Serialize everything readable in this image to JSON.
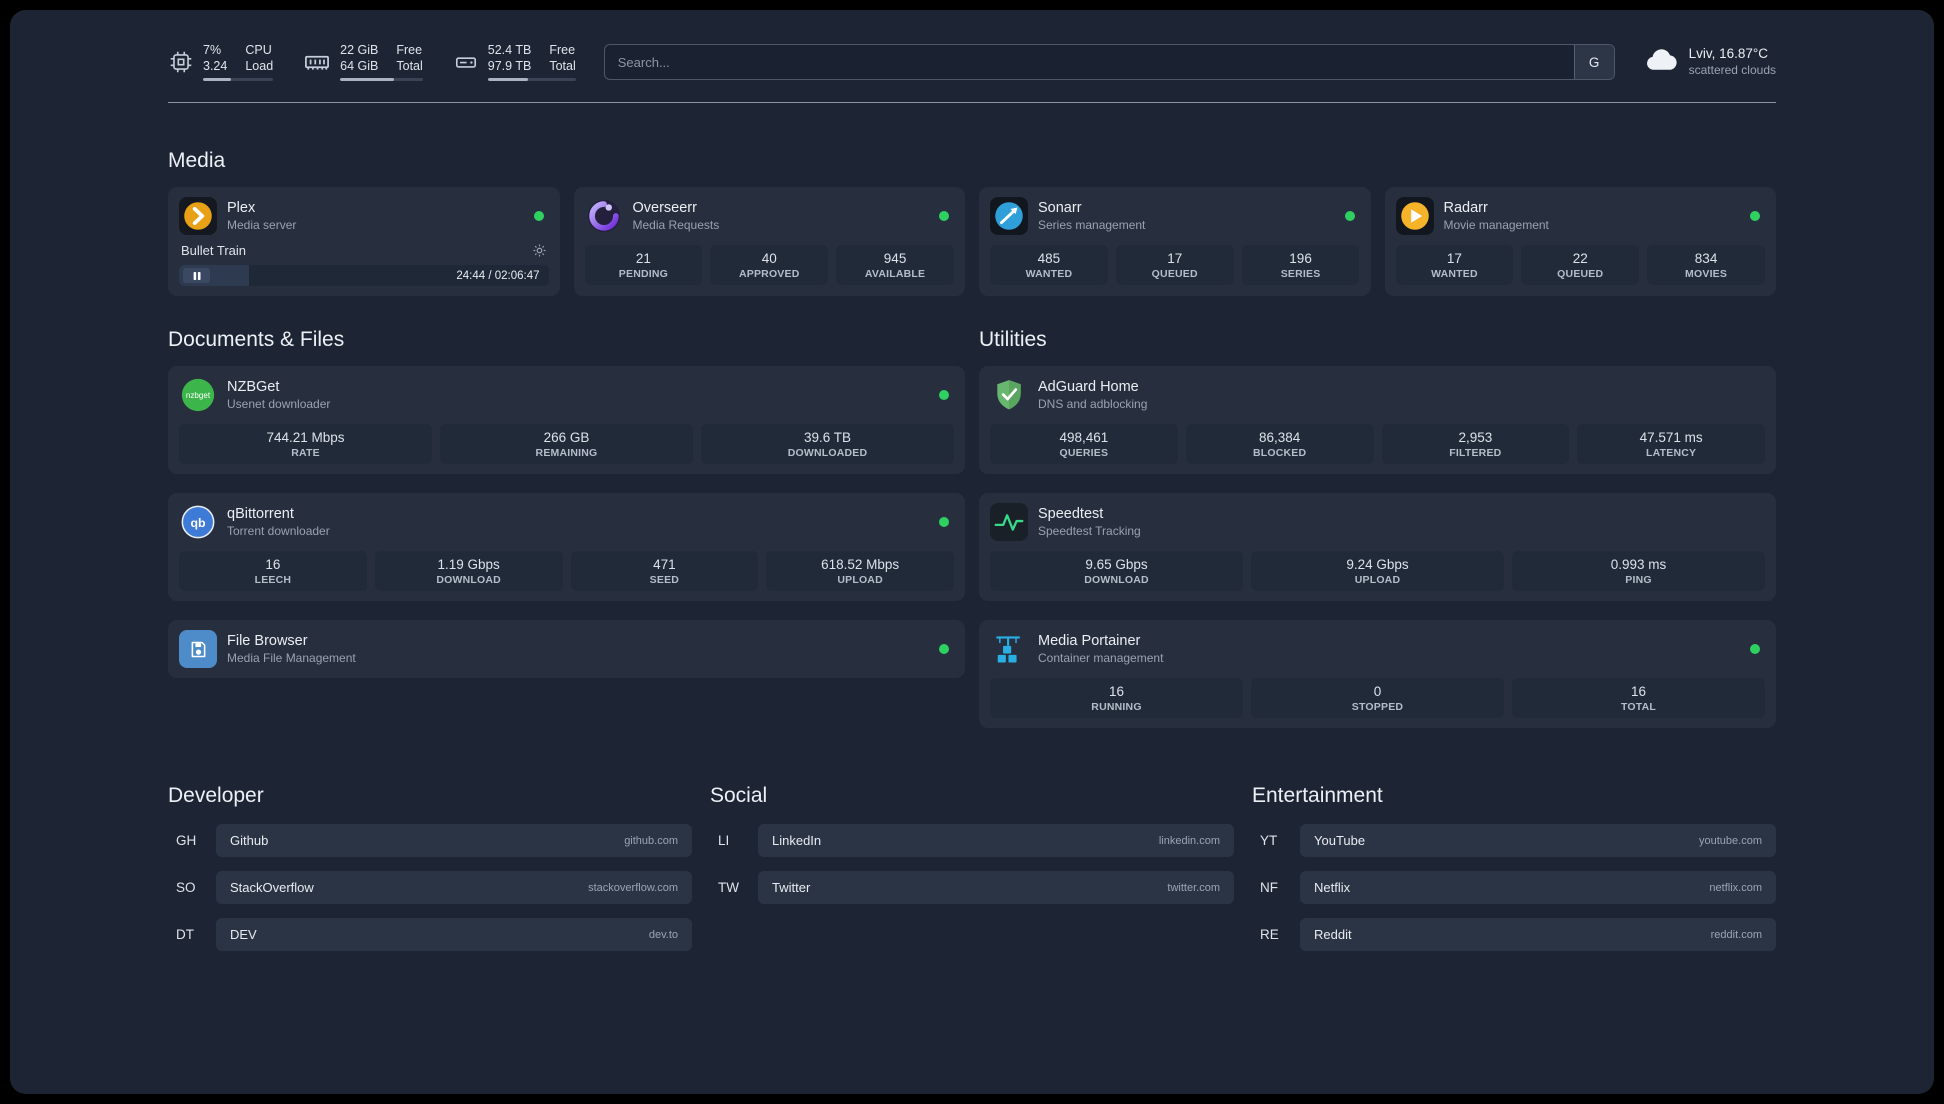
{
  "topbar": {
    "cpu": {
      "line1": "7%",
      "line2": "3.24",
      "label1": "CPU",
      "label2": "Load",
      "bar_percent": 40
    },
    "memory": {
      "line1": "22 GiB",
      "line2": "64 GiB",
      "label1": "Free",
      "label2": "Total",
      "bar_percent": 65
    },
    "disk": {
      "line1": "52.4 TB",
      "line2": "97.9 TB",
      "label1": "Free",
      "label2": "Total",
      "bar_percent": 46
    },
    "search": {
      "placeholder": "Search...",
      "provider": "G"
    },
    "weather": {
      "location": "Lviv, 16.87°C",
      "condition": "scattered clouds"
    }
  },
  "groups": [
    {
      "title": "Media",
      "cards": [
        {
          "name": "Plex",
          "subtitle": "Media server",
          "icon": "plex-icon",
          "status_online": true,
          "player": {
            "title": "Bullet Train",
            "time": "24:44 / 02:06:47",
            "progress_percent": 19
          }
        },
        {
          "name": "Overseerr",
          "subtitle": "Media Requests",
          "icon": "overseerr-icon",
          "status_online": true,
          "stats": [
            {
              "value": "21",
              "label": "PENDING"
            },
            {
              "value": "40",
              "label": "APPROVED"
            },
            {
              "value": "945",
              "label": "AVAILABLE"
            }
          ]
        },
        {
          "name": "Sonarr",
          "subtitle": "Series management",
          "icon": "sonarr-icon",
          "status_online": true,
          "stats": [
            {
              "value": "485",
              "label": "WANTED"
            },
            {
              "value": "17",
              "label": "QUEUED"
            },
            {
              "value": "196",
              "label": "SERIES"
            }
          ]
        },
        {
          "name": "Radarr",
          "subtitle": "Movie management",
          "icon": "radarr-icon",
          "status_online": true,
          "stats": [
            {
              "value": "17",
              "label": "WANTED"
            },
            {
              "value": "22",
              "label": "QUEUED"
            },
            {
              "value": "834",
              "label": "MOVIES"
            }
          ]
        }
      ]
    },
    {
      "title": "Documents & Files",
      "cards": [
        {
          "name": "NZBGet",
          "subtitle": "Usenet downloader",
          "icon": "nzbget-icon",
          "status_online": true,
          "stats": [
            {
              "value": "744.21 Mbps",
              "label": "RATE"
            },
            {
              "value": "266 GB",
              "label": "REMAINING"
            },
            {
              "value": "39.6 TB",
              "label": "DOWNLOADED"
            }
          ]
        },
        {
          "name": "qBittorrent",
          "subtitle": "Torrent downloader",
          "icon": "qbittorrent-icon",
          "status_online": true,
          "stats": [
            {
              "value": "16",
              "label": "LEECH"
            },
            {
              "value": "1.19 Gbps",
              "label": "DOWNLOAD"
            },
            {
              "value": "471",
              "label": "SEED"
            },
            {
              "value": "618.52 Mbps",
              "label": "UPLOAD"
            }
          ]
        },
        {
          "name": "File Browser",
          "subtitle": "Media File Management",
          "icon": "filebrowser-icon",
          "status_online": true
        }
      ]
    },
    {
      "title": "Utilities",
      "cards": [
        {
          "name": "AdGuard Home",
          "subtitle": "DNS and adblocking",
          "icon": "adguard-icon",
          "status_online": false,
          "stats": [
            {
              "value": "498,461",
              "label": "QUERIES"
            },
            {
              "value": "86,384",
              "label": "BLOCKED"
            },
            {
              "value": "2,953",
              "label": "FILTERED"
            },
            {
              "value": "47.571 ms",
              "label": "LATENCY"
            }
          ]
        },
        {
          "name": "Speedtest",
          "subtitle": "Speedtest Tracking",
          "icon": "speedtest-icon",
          "status_online": false,
          "stats": [
            {
              "value": "9.65 Gbps",
              "label": "DOWNLOAD"
            },
            {
              "value": "9.24 Gbps",
              "label": "UPLOAD"
            },
            {
              "value": "0.993 ms",
              "label": "PING"
            }
          ]
        },
        {
          "name": "Media Portainer",
          "subtitle": "Container management",
          "icon": "portainer-icon",
          "status_online": true,
          "stats": [
            {
              "value": "16",
              "label": "RUNNING"
            },
            {
              "value": "0",
              "label": "STOPPED"
            },
            {
              "value": "16",
              "label": "TOTAL"
            }
          ]
        }
      ]
    }
  ],
  "bookmark_groups": [
    {
      "title": "Developer",
      "items": [
        {
          "abbr": "GH",
          "name": "Github",
          "domain": "github.com"
        },
        {
          "abbr": "SO",
          "name": "StackOverflow",
          "domain": "stackoverflow.com"
        },
        {
          "abbr": "DT",
          "name": "DEV",
          "domain": "dev.to"
        }
      ]
    },
    {
      "title": "Social",
      "items": [
        {
          "abbr": "LI",
          "name": "LinkedIn",
          "domain": "linkedin.com"
        },
        {
          "abbr": "TW",
          "name": "Twitter",
          "domain": "twitter.com"
        }
      ]
    },
    {
      "title": "Entertainment",
      "items": [
        {
          "abbr": "YT",
          "name": "YouTube",
          "domain": "youtube.com"
        },
        {
          "abbr": "NF",
          "name": "Netflix",
          "domain": "netflix.com"
        },
        {
          "abbr": "RE",
          "name": "Reddit",
          "domain": "reddit.com"
        }
      ]
    }
  ],
  "colors": {
    "background": "#1d2534",
    "card": "#272f3e",
    "stat_box": "#202a39",
    "status_green": "#2ed161",
    "plex_amber": "#e8a117",
    "speedtest_green": "#39d98a",
    "portainer_blue": "#29afe4"
  }
}
